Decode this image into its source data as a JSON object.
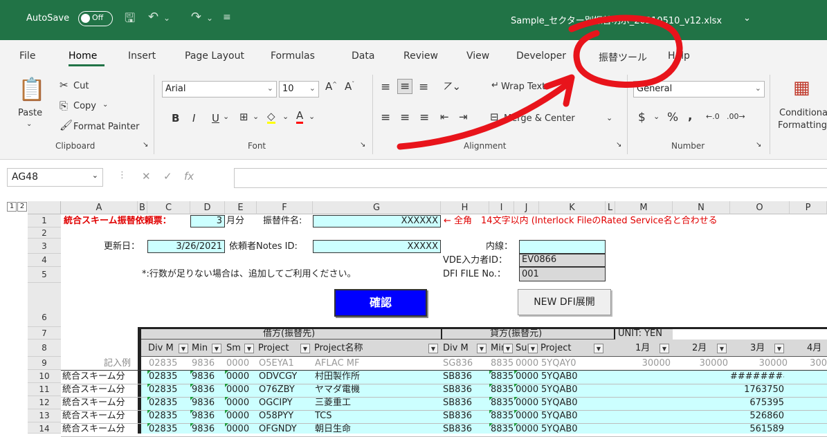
{
  "titlebar": {
    "autosave_label": "AutoSave",
    "autosave_state": "Off",
    "file_name": "Sample_セクター別振替明示_20210510_v12.xlsx"
  },
  "tabs": [
    "File",
    "Home",
    "Insert",
    "Page Layout",
    "Formulas",
    "Data",
    "Review",
    "View",
    "Developer",
    "振替ツール",
    "Help"
  ],
  "ribbon": {
    "clipboard": {
      "paste": "Paste",
      "cut": "Cut",
      "copy": "Copy",
      "format_painter": "Format Painter",
      "group": "Clipboard"
    },
    "font": {
      "name": "Arial",
      "size": "10",
      "group": "Font"
    },
    "alignment": {
      "wrap": "Wrap Text",
      "merge": "Merge & Center",
      "group": "Alignment"
    },
    "number": {
      "format": "General",
      "group": "Number"
    },
    "styles": {
      "conditional1": "Conditional",
      "conditional2": "Formatting"
    }
  },
  "namebox": "AG48",
  "outline_levels": [
    "1",
    "2"
  ],
  "columns": [
    "A",
    "B",
    "C",
    "D",
    "E",
    "F",
    "G",
    "H",
    "I",
    "J",
    "K",
    "L",
    "M",
    "N",
    "O",
    "P"
  ],
  "rows": [
    "1",
    "2",
    "3",
    "4",
    "5",
    "6",
    "7",
    "8",
    "9",
    "10",
    "11",
    "12",
    "13",
    "14"
  ],
  "sheet": {
    "r1_title": "統合スキーム振替依頼票：",
    "r1_month_num": "3",
    "r1_month": "月分",
    "r1_kenmei_label": "振替件名:",
    "r1_kenmei_value": "XXXXXX",
    "r1_note": "← 全角　14文字以内 (Interlock FileのRated Service名と合わせる",
    "r3_updated_label": "更新日：",
    "r3_date": "3/26/2021",
    "r3_notes_label": "依頼者Notes ID:",
    "r3_notes_value": "XXXXX",
    "r3_naisen": "内線：",
    "r4_vde_label": "VDE入力者ID：",
    "r4_vde_value": "EV0866",
    "r5_note": "*:行数が足りない場合は、追加してご利用ください。",
    "r5_dfi_label": "DFI FILE No.：",
    "r5_dfi_value": "001",
    "btn_confirm": "確認",
    "btn_new_dfi": "NEW DFI展開",
    "r7_debit": "借方(振替先)",
    "r7_credit": "貸方(振替元)",
    "r7_unit": "UNIT: YEN",
    "headers": [
      "Div M",
      "Min",
      "Sm",
      "Project",
      "Project名称",
      "Div M",
      "Min",
      "Sul",
      "Project",
      "1月",
      "2月",
      "3月",
      "4月"
    ],
    "r9_label": "記入例",
    "r9": [
      "02835",
      "9836",
      "0000",
      "O5EYA1",
      "AFLAC MF",
      "SG836",
      "8835",
      "0000",
      "5YQAY0",
      "30000",
      "30000",
      "30000",
      "300"
    ],
    "data_rows": [
      {
        "a": "統合スキーム分",
        "c": "02835",
        "d": "9836",
        "e": "0000",
        "f": "ODVCGY",
        "g": "村田製作所",
        "h": "SB836",
        "i": "8835",
        "j": "0000",
        "k": "5YQAB0",
        "o": "########"
      },
      {
        "a": "統合スキーム分",
        "c": "02835",
        "d": "9836",
        "e": "0000",
        "f": "O76ZBY",
        "g": "ヤマダ電機",
        "h": "SB836",
        "i": "8835",
        "j": "0000",
        "k": "5YQAB0",
        "o": "1763750"
      },
      {
        "a": "統合スキーム分",
        "c": "02835",
        "d": "9836",
        "e": "0000",
        "f": "OGCIPY",
        "g": "三菱重工",
        "h": "SB836",
        "i": "8835",
        "j": "0000",
        "k": "5YQAB0",
        "o": "675395"
      },
      {
        "a": "統合スキーム分",
        "c": "02835",
        "d": "9836",
        "e": "0000",
        "f": "O58PYY",
        "g": "TCS",
        "h": "SB836",
        "i": "8835",
        "j": "0000",
        "k": "5YQAB0",
        "o": "526860"
      },
      {
        "a": "統合スキーム分",
        "c": "02835",
        "d": "9836",
        "e": "0000",
        "f": "OFGNDY",
        "g": "朝日生命",
        "h": "SB836",
        "i": "8835",
        "j": "0000",
        "k": "5YQAB0",
        "o": "561589"
      }
    ]
  },
  "colors": {
    "excel_green": "#217346",
    "cyan": "#ccffff",
    "red_annotation": "#e8141b",
    "button_blue": "#0000ff"
  }
}
